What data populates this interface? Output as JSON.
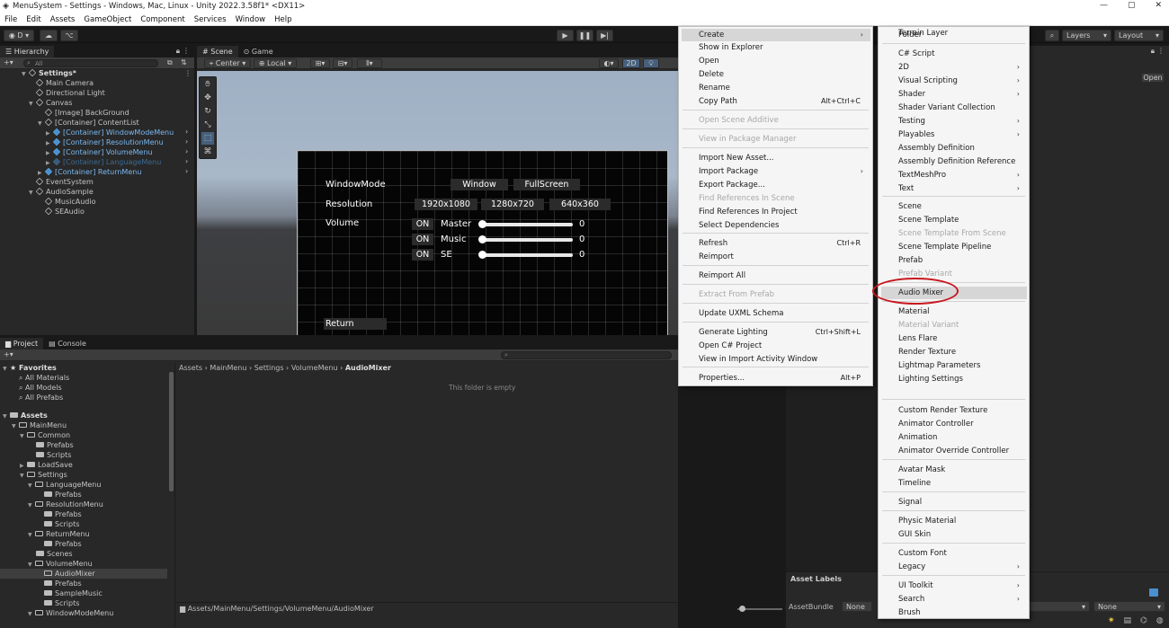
{
  "window": {
    "title": "MenuSystem - Settings - Windows, Mac, Linux - Unity 2022.3.58f1* <DX11>",
    "controls": [
      "—",
      "▢",
      "✕"
    ]
  },
  "menubar": [
    "File",
    "Edit",
    "Assets",
    "GameObject",
    "Component",
    "Services",
    "Window",
    "Help"
  ],
  "toolbar": {
    "account": "D",
    "layers": "Layers",
    "layout": "Layout"
  },
  "hierarchy": {
    "tab": "Hierarchy",
    "search_placeholder": "All",
    "items": [
      {
        "label": "Settings*",
        "bold": true
      },
      {
        "label": "Main Camera"
      },
      {
        "label": "Directional Light"
      },
      {
        "label": "Canvas"
      },
      {
        "label": "[Image] BackGround"
      },
      {
        "label": "[Container] ContentList"
      },
      {
        "label": "[Container] WindowModeMenu"
      },
      {
        "label": "[Container] ResolutionMenu"
      },
      {
        "label": "[Container] VolumeMenu"
      },
      {
        "label": "[Container] LanguageMenu"
      },
      {
        "label": "[Container] ReturnMenu"
      },
      {
        "label": "EventSystem"
      },
      {
        "label": "AudioSample"
      },
      {
        "label": "MusicAudio"
      },
      {
        "label": "SEAudio"
      }
    ]
  },
  "scene": {
    "tabs": [
      "Scene",
      "Game"
    ],
    "pivot": "Center",
    "space": "Local",
    "mode_2d": "2D",
    "game": {
      "window_mode_label": "WindowMode",
      "window_mode_options": [
        "Window",
        "FullScreen"
      ],
      "resolution_label": "Resolution",
      "resolution_options": [
        "1920x1080",
        "1280x720",
        "640x360"
      ],
      "volume_label": "Volume",
      "volumes": [
        {
          "toggle": "ON",
          "name": "Master",
          "value": "0"
        },
        {
          "toggle": "ON",
          "name": "Music",
          "value": "0"
        },
        {
          "toggle": "ON",
          "name": "SE",
          "value": "0"
        }
      ],
      "return_label": "Return"
    }
  },
  "project": {
    "tabs": [
      "Project",
      "Console"
    ],
    "tree": [
      {
        "label": "Favorites",
        "bold": true
      },
      {
        "label": "All Materials"
      },
      {
        "label": "All Models"
      },
      {
        "label": "All Prefabs"
      },
      {
        "label": "Assets",
        "bold": true
      },
      {
        "label": "MainMenu"
      },
      {
        "label": "Common"
      },
      {
        "label": "Prefabs"
      },
      {
        "label": "Scripts"
      },
      {
        "label": "LoadSave"
      },
      {
        "label": "Settings"
      },
      {
        "label": "LanguageMenu"
      },
      {
        "label": "Prefabs"
      },
      {
        "label": "ResolutionMenu"
      },
      {
        "label": "Prefabs"
      },
      {
        "label": "Scripts"
      },
      {
        "label": "ReturnMenu"
      },
      {
        "label": "Prefabs"
      },
      {
        "label": "Scenes"
      },
      {
        "label": "VolumeMenu"
      },
      {
        "label": "AudioMixer"
      },
      {
        "label": "Prefabs"
      },
      {
        "label": "SampleMusic"
      },
      {
        "label": "Scripts"
      },
      {
        "label": "WindowModeMenu"
      }
    ],
    "breadcrumb": [
      "Assets",
      "MainMenu",
      "Settings",
      "VolumeMenu",
      "AudioMixer"
    ],
    "empty_message": "This folder is empty",
    "footer_path": "Assets/MainMenu/Settings/VolumeMenu/AudioMixer"
  },
  "inspector": {
    "open_button": "Open",
    "asset_labels": "Asset Labels",
    "asset_bundle": "AssetBundle",
    "bundle_value": "None",
    "variant_value": "None"
  },
  "context_menu": {
    "items": [
      {
        "label": "Create",
        "submenu": true,
        "highlight": true
      },
      {
        "label": "Show in Explorer"
      },
      {
        "label": "Open"
      },
      {
        "label": "Delete"
      },
      {
        "label": "Rename"
      },
      {
        "label": "Copy Path",
        "shortcut": "Alt+Ctrl+C"
      },
      {
        "label": "Open Scene Additive",
        "disabled": true
      },
      {
        "label": "View in Package Manager",
        "disabled": true
      },
      {
        "label": "Import New Asset..."
      },
      {
        "label": "Import Package",
        "submenu": true
      },
      {
        "label": "Export Package..."
      },
      {
        "label": "Find References In Scene",
        "disabled": true
      },
      {
        "label": "Find References In Project"
      },
      {
        "label": "Select Dependencies"
      },
      {
        "label": "Refresh",
        "shortcut": "Ctrl+R"
      },
      {
        "label": "Reimport"
      },
      {
        "label": "Reimport All"
      },
      {
        "label": "Extract From Prefab",
        "disabled": true
      },
      {
        "label": "Update UXML Schema"
      },
      {
        "label": "Generate Lighting",
        "shortcut": "Ctrl+Shift+L"
      },
      {
        "label": "Open C# Project"
      },
      {
        "label": "View in Import Activity Window"
      },
      {
        "label": "Properties...",
        "shortcut": "Alt+P"
      }
    ]
  },
  "create_menu": {
    "items": [
      {
        "label": "Folder"
      },
      {
        "label": "C# Script"
      },
      {
        "label": "2D",
        "submenu": true
      },
      {
        "label": "Visual Scripting",
        "submenu": true
      },
      {
        "label": "Shader",
        "submenu": true
      },
      {
        "label": "Shader Variant Collection"
      },
      {
        "label": "Testing",
        "submenu": true
      },
      {
        "label": "Playables",
        "submenu": true
      },
      {
        "label": "Assembly Definition"
      },
      {
        "label": "Assembly Definition Reference"
      },
      {
        "label": "TextMeshPro",
        "submenu": true
      },
      {
        "label": "Text",
        "submenu": true
      },
      {
        "label": "Scene"
      },
      {
        "label": "Scene Template"
      },
      {
        "label": "Scene Template From Scene",
        "disabled": true
      },
      {
        "label": "Scene Template Pipeline"
      },
      {
        "label": "Prefab"
      },
      {
        "label": "Prefab Variant",
        "disabled": true
      },
      {
        "label": "Audio Mixer",
        "highlight": true
      },
      {
        "label": "Material"
      },
      {
        "label": "Material Variant",
        "disabled": true
      },
      {
        "label": "Lens Flare"
      },
      {
        "label": "Render Texture"
      },
      {
        "label": "Lightmap Parameters"
      },
      {
        "label": "Lighting Settings"
      },
      {
        "label": "Custom Render Texture"
      },
      {
        "label": "Animator Controller"
      },
      {
        "label": "Animation"
      },
      {
        "label": "Animator Override Controller"
      },
      {
        "label": "Avatar Mask"
      },
      {
        "label": "Timeline"
      },
      {
        "label": "Signal"
      },
      {
        "label": "Physic Material"
      },
      {
        "label": "GUI Skin"
      },
      {
        "label": "Custom Font"
      },
      {
        "label": "Legacy",
        "submenu": true
      },
      {
        "label": "UI Toolkit",
        "submenu": true
      },
      {
        "label": "Search",
        "submenu": true
      },
      {
        "label": "Brush"
      },
      {
        "label": "Terrain Layer"
      }
    ]
  },
  "colors": {
    "editor_bg": "#282828",
    "selection_blue": "#4a8fd0",
    "annotation_red": "#c8161d",
    "menu_bg": "#f5f5f5"
  }
}
